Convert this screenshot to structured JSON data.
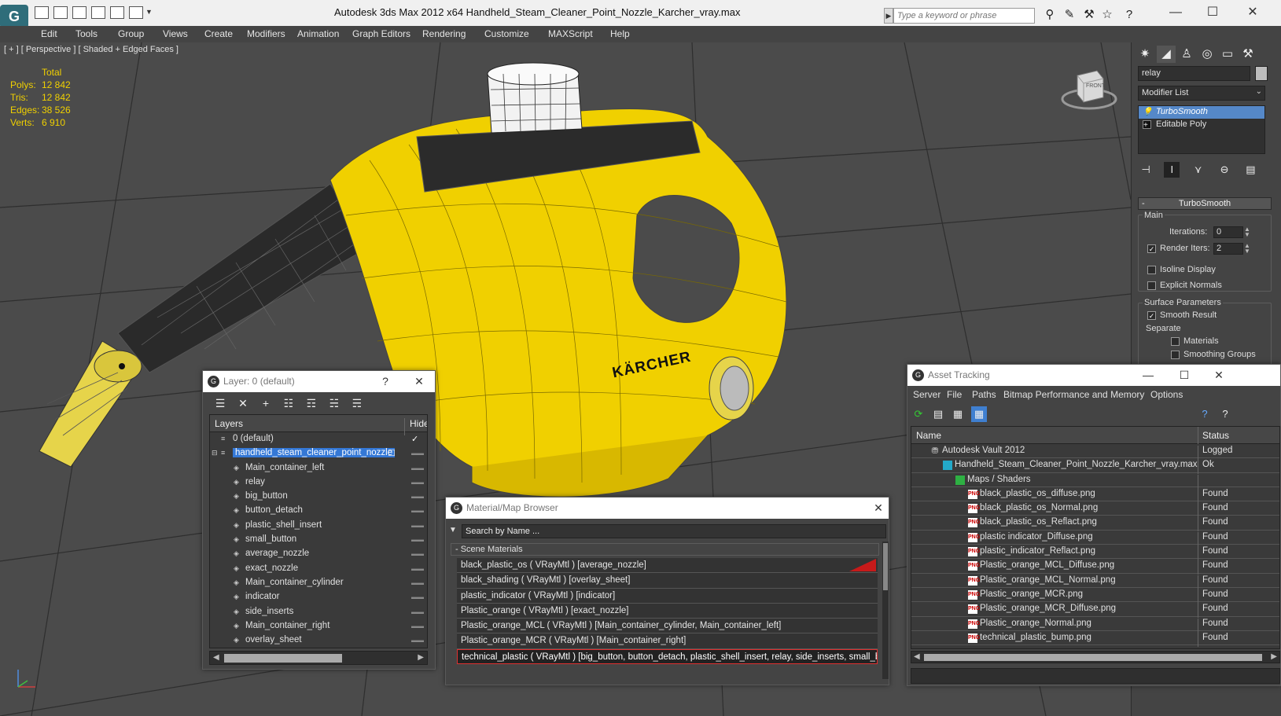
{
  "window": {
    "title": "Autodesk 3ds Max  2012 x64        Handheld_Steam_Cleaner_Point_Nozzle_Karcher_vray.max",
    "search_placeholder": "Type a keyword or phrase"
  },
  "menu": [
    "Edit",
    "Tools",
    "Group",
    "Views",
    "Create",
    "Modifiers",
    "Animation",
    "Graph Editors",
    "Rendering",
    "Customize",
    "MAXScript",
    "Help"
  ],
  "viewport": {
    "label": "[ + ] [ Perspective ] [ Shaded + Edged Faces ]",
    "stats_header": "Total",
    "stats": [
      {
        "label": "Polys:",
        "value": "12 842"
      },
      {
        "label": "Tris:",
        "value": "12 842"
      },
      {
        "label": "Edges:",
        "value": "38 526"
      },
      {
        "label": "Verts:",
        "value": "6 910"
      }
    ],
    "viewcube_face": "FRONT",
    "brand_text": "KÄRCHER"
  },
  "command_panel": {
    "object_name": "relay",
    "modifier_list": "Modifier List",
    "stack": [
      {
        "label": "TurboSmooth",
        "selected": true
      },
      {
        "label": "Editable Poly",
        "selected": false
      }
    ],
    "rollout_title": "TurboSmooth",
    "main_group": "Main",
    "iterations_label": "Iterations:",
    "iterations_value": "0",
    "render_iters_label": "Render Iters:",
    "render_iters_value": "2",
    "isoline_label": "Isoline Display",
    "explicit_label": "Explicit Normals",
    "surface_group": "Surface Parameters",
    "smooth_result_label": "Smooth Result",
    "separate_label": "Separate",
    "materials_label": "Materials",
    "smoothing_groups_label": "Smoothing Groups"
  },
  "layer_dialog": {
    "title": "Layer: 0 (default)",
    "help": "?",
    "close": "✕",
    "col_layers": "Layers",
    "col_hide": "Hide",
    "layers": [
      {
        "name": "0 (default)",
        "level": 0
      },
      {
        "name": "handheld_steam_cleaner_point_nozzle",
        "level": 0,
        "selected": true
      },
      {
        "name": "Main_container_left",
        "level": 1
      },
      {
        "name": "relay",
        "level": 1
      },
      {
        "name": "big_button",
        "level": 1
      },
      {
        "name": "button_detach",
        "level": 1
      },
      {
        "name": "plastic_shell_insert",
        "level": 1
      },
      {
        "name": "small_button",
        "level": 1
      },
      {
        "name": "average_nozzle",
        "level": 1
      },
      {
        "name": "exact_nozzle",
        "level": 1
      },
      {
        "name": "Main_container_cylinder",
        "level": 1
      },
      {
        "name": "indicator",
        "level": 1
      },
      {
        "name": "side_inserts",
        "level": 1
      },
      {
        "name": "Main_container_right",
        "level": 1
      },
      {
        "name": "overlay_sheet",
        "level": 1
      }
    ]
  },
  "material_browser": {
    "title": "Material/Map Browser",
    "close": "✕",
    "search_placeholder": "Search by Name ...",
    "group": "- Scene Materials",
    "materials": [
      "black_plastic_os  ( VRayMtl ) [average_nozzle]",
      "black_shading  ( VRayMtl ) [overlay_sheet]",
      "plastic_indicator  ( VRayMtl ) [indicator]",
      "Plastic_orange  ( VRayMtl ) [exact_nozzle]",
      "Plastic_orange_MCL  ( VRayMtl ) [Main_container_cylinder, Main_container_left]",
      "Plastic_orange_MCR  ( VRayMtl ) [Main_container_right]",
      "technical_plastic  ( VRayMtl ) [big_button, button_detach, plastic_shell_insert, relay, side_inserts, small_b..."
    ]
  },
  "asset_tracking": {
    "title": "Asset Tracking",
    "minimize": "—",
    "maximize": "☐",
    "close": "✕",
    "menu": [
      "Server",
      "File",
      "Paths",
      "Bitmap Performance and Memory",
      "Options"
    ],
    "col_name": "Name",
    "col_status": "Status",
    "rows": [
      {
        "name": "Autodesk Vault 2012",
        "status": "Logged",
        "indent": 24,
        "icon": "vault"
      },
      {
        "name": "Handheld_Steam_Cleaner_Point_Nozzle_Karcher_vray.max",
        "status": "Ok",
        "indent": 40,
        "icon": "file"
      },
      {
        "name": "Maps / Shaders",
        "status": "",
        "indent": 56,
        "icon": "folder"
      },
      {
        "name": "black_plastic_os_diffuse.png",
        "status": "Found",
        "indent": 72,
        "icon": "png"
      },
      {
        "name": "black_plastic_os_Normal.png",
        "status": "Found",
        "indent": 72,
        "icon": "png"
      },
      {
        "name": "black_plastic_os_Reflact.png",
        "status": "Found",
        "indent": 72,
        "icon": "png"
      },
      {
        "name": "plastic indicator_Diffuse.png",
        "status": "Found",
        "indent": 72,
        "icon": "png"
      },
      {
        "name": "plastic_indicator_Reflact.png",
        "status": "Found",
        "indent": 72,
        "icon": "png"
      },
      {
        "name": "Plastic_orange_MCL_Diffuse.png",
        "status": "Found",
        "indent": 72,
        "icon": "png"
      },
      {
        "name": "Plastic_orange_MCL_Normal.png",
        "status": "Found",
        "indent": 72,
        "icon": "png"
      },
      {
        "name": "Plastic_orange_MCR.png",
        "status": "Found",
        "indent": 72,
        "icon": "png"
      },
      {
        "name": "Plastic_orange_MCR_Diffuse.png",
        "status": "Found",
        "indent": 72,
        "icon": "png"
      },
      {
        "name": "Plastic_orange_Normal.png",
        "status": "Found",
        "indent": 72,
        "icon": "png"
      },
      {
        "name": "technical_plastic_bump.png",
        "status": "Found",
        "indent": 72,
        "icon": "png"
      }
    ]
  }
}
